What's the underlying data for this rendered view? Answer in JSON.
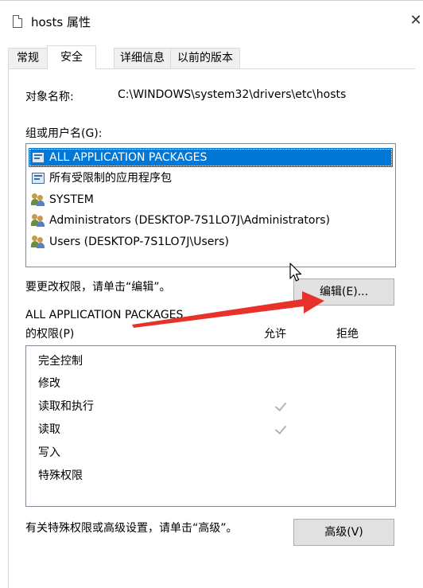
{
  "window": {
    "title": "hosts 属性",
    "close_glyph": "✕"
  },
  "tabs": [
    {
      "label": "常规"
    },
    {
      "label": "安全",
      "active": true
    },
    {
      "label": "详细信息"
    },
    {
      "label": "以前的版本"
    }
  ],
  "object": {
    "label": "对象名称:",
    "value": "C:\\WINDOWS\\system32\\drivers\\etc\\hosts"
  },
  "groups": {
    "label": "组或用户名(G):",
    "items": [
      {
        "name": "ALL APPLICATION PACKAGES",
        "icon": "package-icon",
        "selected": true
      },
      {
        "name": "所有受限制的应用程序包",
        "icon": "package-icon"
      },
      {
        "name": "SYSTEM",
        "icon": "users-icon"
      },
      {
        "name": "Administrators (DESKTOP-7S1LO7J\\Administrators)",
        "icon": "users-icon"
      },
      {
        "name": "Users (DESKTOP-7S1LO7J\\Users)",
        "icon": "users-icon"
      }
    ]
  },
  "edit": {
    "hint": "要更改权限，请单击“编辑”。",
    "button_label": "编辑(E)..."
  },
  "permissions": {
    "title_line1": "ALL APPLICATION PACKAGES",
    "title_line2": "的权限(P)",
    "allow_header": "允许",
    "deny_header": "拒绝",
    "rows": [
      {
        "name": "完全控制",
        "allow": false,
        "deny": false
      },
      {
        "name": "修改",
        "allow": false,
        "deny": false
      },
      {
        "name": "读取和执行",
        "allow": true,
        "deny": false
      },
      {
        "name": "读取",
        "allow": true,
        "deny": false
      },
      {
        "name": "写入",
        "allow": false,
        "deny": false
      },
      {
        "name": "特殊权限",
        "allow": false,
        "deny": false
      }
    ]
  },
  "advanced": {
    "hint": "有关特殊权限或高级设置，请单击“高级”。",
    "button_label": "高级(V)"
  },
  "colors": {
    "selection": "#0078d7",
    "annotation_arrow": "#e8312a",
    "check": "#b4b4b4"
  }
}
